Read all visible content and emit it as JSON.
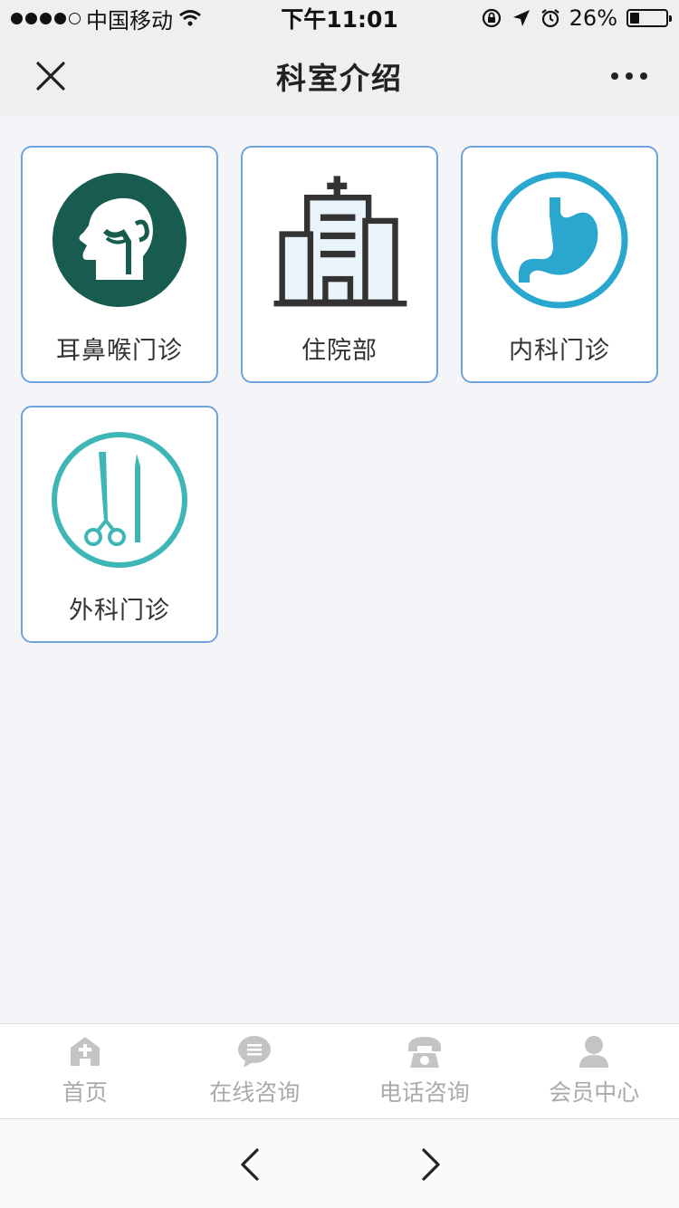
{
  "status_bar": {
    "carrier": "中国移动",
    "time": "下午11:01",
    "battery": "26%",
    "battery_level": 0.26
  },
  "nav": {
    "title": "科室介绍",
    "close_icon": "close-icon",
    "more_icon": "more-icon"
  },
  "departments": [
    {
      "label": "耳鼻喉门诊",
      "icon": "ent-head-icon",
      "color": "#175c4f"
    },
    {
      "label": "住院部",
      "icon": "hospital-building-icon",
      "color": "#333333"
    },
    {
      "label": "内科门诊",
      "icon": "stomach-icon",
      "color": "#2aa7cf"
    },
    {
      "label": "外科门诊",
      "icon": "surgical-tools-icon",
      "color": "#3fb6b6"
    }
  ],
  "tab_bar": {
    "tabs": [
      {
        "label": "首页",
        "icon": "home-icon"
      },
      {
        "label": "在线咨询",
        "icon": "chat-icon"
      },
      {
        "label": "电话咨询",
        "icon": "phone-icon"
      },
      {
        "label": "会员中心",
        "icon": "user-icon"
      }
    ]
  },
  "browser": {
    "back_icon": "back-arrow-icon",
    "forward_icon": "forward-arrow-icon"
  },
  "colors": {
    "card_border": "#6ea3dd",
    "tab_inactive": "#aaaaaa",
    "background": "#f5f5f9"
  }
}
